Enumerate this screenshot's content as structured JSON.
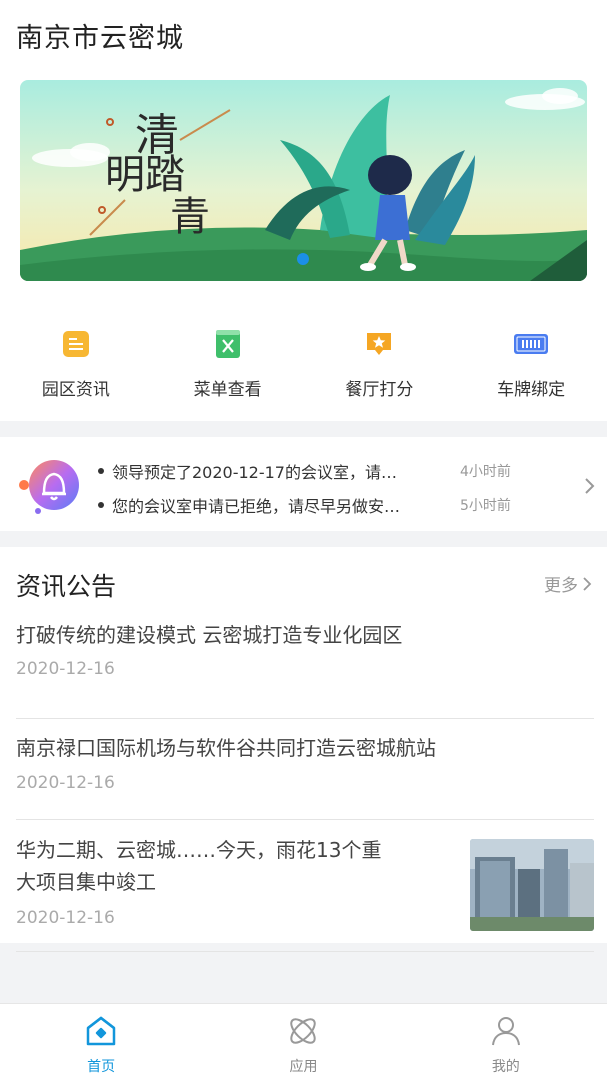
{
  "header": {
    "title": "南京市云密城"
  },
  "banner": {
    "text_line1": "清",
    "text_line2": "明踏",
    "text_line3": "青",
    "dots_total": 1,
    "active_dot": 1
  },
  "quick_menu": [
    {
      "label": "园区资讯",
      "icon": "news-doc-icon",
      "color": "#f5b833"
    },
    {
      "label": "菜单查看",
      "icon": "menu-list-icon",
      "color": "#3fbf6b"
    },
    {
      "label": "餐厅打分",
      "icon": "rating-star-icon",
      "color": "#f5a623"
    },
    {
      "label": "车牌绑定",
      "icon": "license-plate-icon",
      "color": "#4a7cf0"
    }
  ],
  "notices": [
    {
      "text": "领导预定了2020-12-17的会议室，请…",
      "time": "4小时前"
    },
    {
      "text": "您的会议室申请已拒绝，请尽早另做安…",
      "time": "5小时前"
    }
  ],
  "news": {
    "title": "资讯公告",
    "more": "更多",
    "items": [
      {
        "title": "打破传统的建设模式 云密城打造专业化园区",
        "date": "2020-12-16"
      },
      {
        "title": "南京禄口国际机场与软件谷共同打造云密城航站",
        "date": "2020-12-16"
      },
      {
        "title_line1": "华为二期、云密城……今天，雨花13个重",
        "title_line2": "大项目集中竣工",
        "date": "2020-12-16"
      }
    ]
  },
  "tabs": [
    {
      "label": "首页",
      "icon": "home-icon",
      "active": true
    },
    {
      "label": "应用",
      "icon": "apps-icon",
      "active": false
    },
    {
      "label": "我的",
      "icon": "profile-icon",
      "active": false
    }
  ],
  "colors": {
    "accent": "#1296db"
  }
}
